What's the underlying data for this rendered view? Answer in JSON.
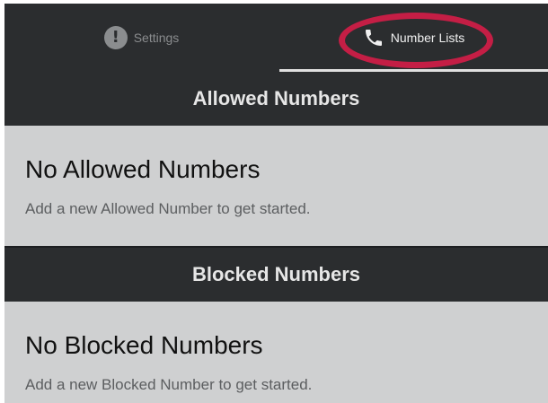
{
  "tabs": [
    {
      "label": "Settings",
      "icon": "exclamation-circle-icon",
      "selected": false
    },
    {
      "label": "Number Lists",
      "icon": "phone-icon",
      "selected": true
    }
  ],
  "allowed": {
    "header": "Allowed Numbers",
    "empty_title": "No Allowed Numbers",
    "empty_subtitle": "Add a new Allowed Number to get started."
  },
  "blocked": {
    "header": "Blocked Numbers",
    "empty_title": "No Blocked Numbers",
    "empty_subtitle": "Add a new Blocked Number to get started."
  },
  "colors": {
    "bar_bg": "#2b2d2f",
    "panel_bg": "#cfd0d1",
    "highlight_ring": "#c41e45"
  }
}
